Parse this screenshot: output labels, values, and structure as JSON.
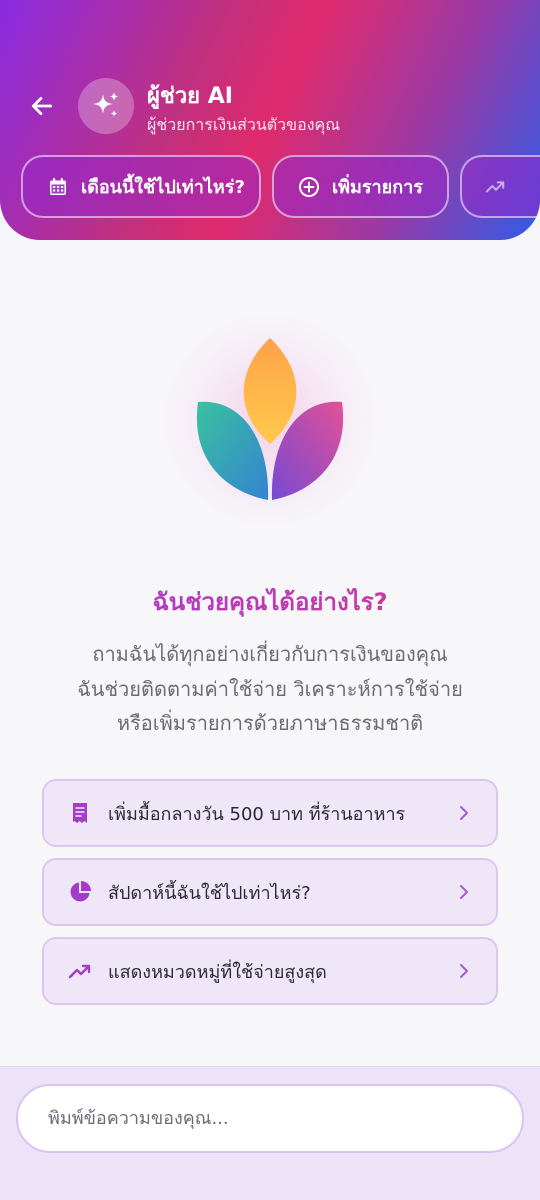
{
  "header": {
    "title": "ผู้ช่วย AI",
    "subtitle": "ผู้ช่วยการเงินส่วนตัวของคุณ",
    "back_icon": "arrow-left-icon",
    "avatar_icon": "sparkles-icon"
  },
  "quick_actions": [
    {
      "label": "เดือนนี้ใช้ไปเท่าไหร่?",
      "icon": "calendar-icon"
    },
    {
      "label": "เพิ่มรายการ",
      "icon": "plus-circle-icon"
    },
    {
      "label": "",
      "icon": "trending-up-icon"
    }
  ],
  "empty_state": {
    "logo": "lotus-logo",
    "heading": "ฉันช่วยคุณได้อย่างไร?",
    "description_lines": [
      "ถามฉันได้ทุกอย่างเกี่ยวกับการเงินของคุณ",
      "ฉันช่วยติดตามค่าใช้จ่าย วิเคราะห์การใช้จ่าย",
      "หรือเพิ่มรายการด้วยภาษาธรรมชาติ"
    ]
  },
  "suggestions": [
    {
      "label": "เพิ่มมื้อกลางวัน 500 บาท ที่ร้านอาหาร",
      "icon": "receipt-icon"
    },
    {
      "label": "สัปดาห์นี้ฉันใช้ไปเท่าไหร่?",
      "icon": "pie-chart-icon"
    },
    {
      "label": "แสดงหมวดหมู่ที่ใช้จ่ายสูงสุด",
      "icon": "trending-up-icon"
    }
  ],
  "chat_input": {
    "placeholder": "พิมพ์ข้อความของคุณ..."
  },
  "colors": {
    "accent": "#a73ad8",
    "chip_bg": "#efe6f7",
    "chip_border": "#dcc6f0"
  }
}
